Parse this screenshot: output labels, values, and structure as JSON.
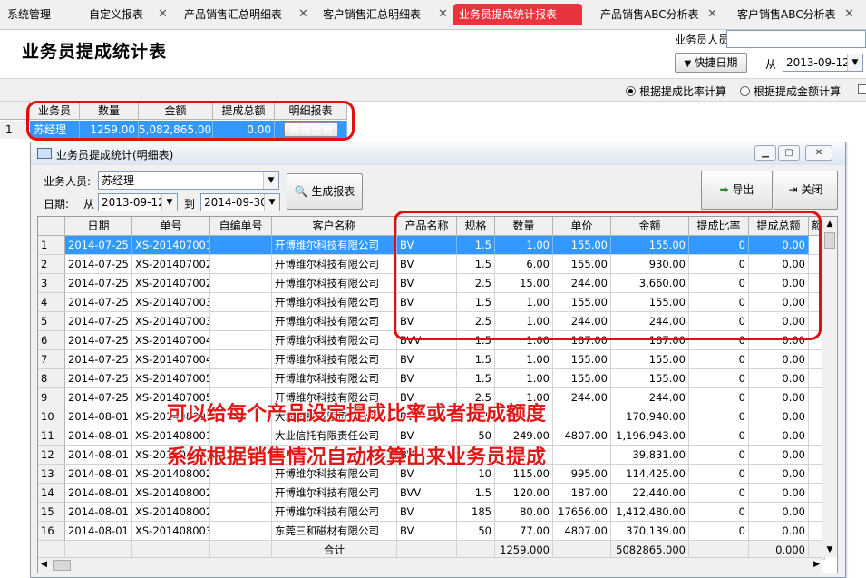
{
  "tabs": [
    {
      "label": "系统管理"
    },
    {
      "label": "自定义报表"
    },
    {
      "label": "产品销售汇总明细表"
    },
    {
      "label": "客户销售汇总明细表"
    },
    {
      "label": "业务员提成统计报表"
    },
    {
      "label": "产品销售ABC分析表"
    },
    {
      "label": "客户销售ABC分析表"
    }
  ],
  "tab_close": "✕",
  "header": {
    "title": "业务员提成统计表",
    "salesperson_label": "业务员人员:",
    "salesperson_value": "",
    "quick_date": "快捷日期",
    "from_label": "从",
    "from_date": "2013-09-12"
  },
  "options": {
    "by_rate": "根据提成比率计算",
    "by_amount": "根据提成金额计算",
    "selected": "by_rate"
  },
  "summary": {
    "headers": [
      "业务员",
      "数量",
      "金额",
      "提成总额",
      "明细报表"
    ],
    "row": {
      "num": "1",
      "name": "苏经理",
      "qty": "1259.00",
      "amount": "5,082,865.00",
      "commission": "0.00",
      "button": "点击查看"
    }
  },
  "window": {
    "title": "业务员提成统计(明细表)",
    "salesperson_label": "业务人员:",
    "salesperson_value": "苏经理",
    "date_label": "日期:",
    "from_label": "从",
    "from_date": "2013-09-12",
    "to_label": "到",
    "to_date": "2014-09-30",
    "generate": "生成报表",
    "export": "导出",
    "close": "关闭"
  },
  "grid": {
    "headers": [
      "日期",
      "单号",
      "自编单号",
      "客户名称",
      "产品名称",
      "规格",
      "数量",
      "单价",
      "金额",
      "提成比率",
      "提成总额",
      "额"
    ],
    "rows": [
      [
        "1",
        "2014-07-25",
        "XS-201407001",
        "",
        "开博维尔科技有限公司",
        "BV",
        "1.5",
        "1.00",
        "155.00",
        "155.00",
        "0",
        "0.00"
      ],
      [
        "2",
        "2014-07-25",
        "XS-201407002",
        "",
        "开博维尔科技有限公司",
        "BV",
        "1.5",
        "6.00",
        "155.00",
        "930.00",
        "0",
        "0.00"
      ],
      [
        "3",
        "2014-07-25",
        "XS-201407002",
        "",
        "开博维尔科技有限公司",
        "BV",
        "2.5",
        "15.00",
        "244.00",
        "3,660.00",
        "0",
        "0.00"
      ],
      [
        "4",
        "2014-07-25",
        "XS-201407003",
        "",
        "开博维尔科技有限公司",
        "BV",
        "1.5",
        "1.00",
        "155.00",
        "155.00",
        "0",
        "0.00"
      ],
      [
        "5",
        "2014-07-25",
        "XS-201407003",
        "",
        "开博维尔科技有限公司",
        "BV",
        "2.5",
        "1.00",
        "244.00",
        "244.00",
        "0",
        "0.00"
      ],
      [
        "6",
        "2014-07-25",
        "XS-201407004",
        "",
        "开博维尔科技有限公司",
        "BVV",
        "1.5",
        "1.00",
        "187.00",
        "187.00",
        "0",
        "0.00"
      ],
      [
        "7",
        "2014-07-25",
        "XS-201407004",
        "",
        "开博维尔科技有限公司",
        "BV",
        "1.5",
        "1.00",
        "155.00",
        "155.00",
        "0",
        "0.00"
      ],
      [
        "8",
        "2014-07-25",
        "XS-201407005",
        "",
        "开博维尔科技有限公司",
        "BV",
        "1.5",
        "1.00",
        "155.00",
        "155.00",
        "0",
        "0.00"
      ],
      [
        "9",
        "2014-07-25",
        "XS-201407005",
        "",
        "开博维尔科技有限公司",
        "BV",
        "2.5",
        "1.00",
        "244.00",
        "244.00",
        "0",
        "0.00"
      ],
      [
        "10",
        "2014-08-01",
        "XS-201408001",
        "",
        "大业信托有限责任公司",
        "BV",
        "1.5",
        "",
        "",
        "170,940.00",
        "0",
        "0.00"
      ],
      [
        "11",
        "2014-08-01",
        "XS-201408001",
        "",
        "大业信托有限责任公司",
        "BV",
        "50",
        "249.00",
        "4807.00",
        "1,196,943.00",
        "0",
        "0.00"
      ],
      [
        "12",
        "2014-08-01",
        "XS-201408002",
        "",
        "",
        "BV",
        "",
        "",
        "",
        "39,831.00",
        "0",
        "0.00"
      ],
      [
        "13",
        "2014-08-01",
        "XS-201408002",
        "",
        "开博维尔科技有限公司",
        "BV",
        "10",
        "115.00",
        "995.00",
        "114,425.00",
        "0",
        "0.00"
      ],
      [
        "14",
        "2014-08-01",
        "XS-201408002",
        "",
        "开博维尔科技有限公司",
        "BVV",
        "1.5",
        "120.00",
        "187.00",
        "22,440.00",
        "0",
        "0.00"
      ],
      [
        "15",
        "2014-08-01",
        "XS-201408002",
        "",
        "开博维尔科技有限公司",
        "BV",
        "185",
        "80.00",
        "17656.00",
        "1,412,480.00",
        "0",
        "0.00"
      ],
      [
        "16",
        "2014-08-01",
        "XS-201408003",
        "",
        "东莞三和磁材有限公司",
        "BV",
        "50",
        "77.00",
        "4807.00",
        "370,139.00",
        "0",
        "0.00"
      ]
    ],
    "footer": {
      "label": "合计",
      "qty": "1259.000",
      "amount": "5082865.000",
      "commission": "0.000"
    }
  },
  "annotation": {
    "line1": "可以给每个产品设定提成比率或者提成额度",
    "line2": "系统根据销售情况自动核算出来业务员提成"
  },
  "colors": {
    "selection": "#3399ff",
    "annotation": "#e01010",
    "active_tab": "#e8343c"
  }
}
